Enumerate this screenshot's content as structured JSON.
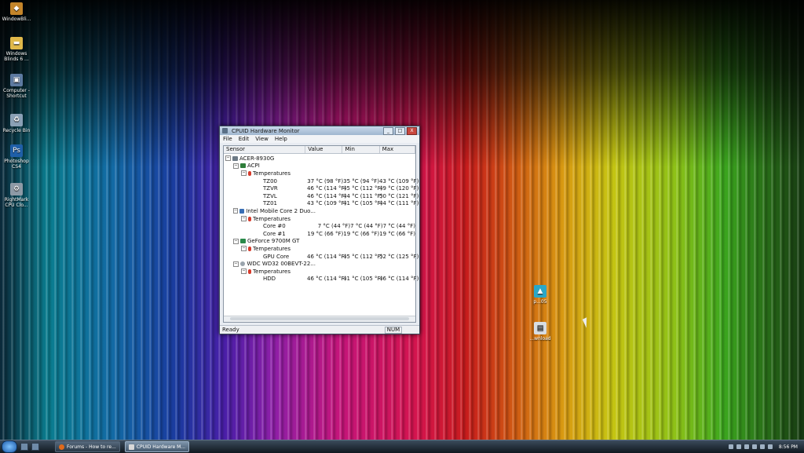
{
  "desktop": {
    "icons": [
      {
        "label": "WindowBli...",
        "icon": "windowblinds-icon",
        "color": "#c4852a"
      },
      {
        "label": "Windows Blinds 6 ...",
        "icon": "folder-icon",
        "color": "#e0b94a"
      },
      {
        "label": "Computer - Shortcut",
        "icon": "computer-icon",
        "color": "#5d7aa0"
      },
      {
        "label": "Recycle Bin",
        "icon": "recycle-bin-icon",
        "color": "#8aa0b5"
      },
      {
        "label": "Photoshop CS4",
        "icon": "photoshop-icon",
        "color": "#1f5fa8"
      },
      {
        "label": "RightMark CPU Clo...",
        "icon": "gear-icon",
        "color": "#8e9aa6"
      },
      {
        "label": "p...05",
        "icon": "image-icon",
        "color": "#2aa7c7"
      },
      {
        "label": "...wnload",
        "icon": "file-icon",
        "color": "#d8dde3"
      }
    ]
  },
  "window": {
    "title": "CPUID Hardware Monitor",
    "controls": {
      "minimize": "_",
      "maximize": "□",
      "close": "X"
    },
    "menu": [
      "File",
      "Edit",
      "View",
      "Help"
    ],
    "columns": [
      "Sensor",
      "Value",
      "Min",
      "Max"
    ],
    "rows": [
      {
        "label": "ACER-8930G",
        "value": "",
        "min": "",
        "max": ""
      },
      {
        "label": "ACPI",
        "value": "",
        "min": "",
        "max": ""
      },
      {
        "label": "Temperatures",
        "value": "",
        "min": "",
        "max": ""
      },
      {
        "label": "TZ00",
        "value": "37 °C  (98 °F)",
        "min": "35 °C  (94 °F)",
        "max": "43 °C  (109 °F)"
      },
      {
        "label": "TZVR",
        "value": "46 °C  (114 °F)",
        "min": "45 °C  (112 °F)",
        "max": "49 °C  (120 °F)"
      },
      {
        "label": "TZVL",
        "value": "46 °C  (114 °F)",
        "min": "44 °C  (111 °F)",
        "max": "50 °C  (121 °F)"
      },
      {
        "label": "TZ01",
        "value": "43 °C  (109 °F)",
        "min": "41 °C  (105 °F)",
        "max": "44 °C  (111 °F)"
      },
      {
        "label": "Intel Mobile Core 2 Duo...",
        "value": "",
        "min": "",
        "max": ""
      },
      {
        "label": "Temperatures",
        "value": "",
        "min": "",
        "max": ""
      },
      {
        "label": "Core #0",
        "value": "7 °C  (44 °F)",
        "min": "7 °C  (44 °F)",
        "max": "7 °C  (44 °F)"
      },
      {
        "label": "Core #1",
        "value": "19 °C  (66 °F)",
        "min": "19 °C  (66 °F)",
        "max": "19 °C  (66 °F)"
      },
      {
        "label": "GeForce 9700M GT",
        "value": "",
        "min": "",
        "max": ""
      },
      {
        "label": "Temperatures",
        "value": "",
        "min": "",
        "max": ""
      },
      {
        "label": "GPU Core",
        "value": "46 °C  (114 °F)",
        "min": "45 °C  (112 °F)",
        "max": "52 °C  (125 °F)"
      },
      {
        "label": "WDC WD32 00BEVT-22...",
        "value": "",
        "min": "",
        "max": ""
      },
      {
        "label": "Temperatures",
        "value": "",
        "min": "",
        "max": ""
      },
      {
        "label": "HDD",
        "value": "46 °C  (114 °F)",
        "min": "41 °C  (105 °F)",
        "max": "46 °C  (114 °F)"
      }
    ],
    "status": "Ready",
    "status_num": "NUM"
  },
  "taskbar": {
    "tasks": [
      {
        "label": "Forums - How to re...",
        "icon": "firefox-icon",
        "active": false,
        "color": "#e06a1b"
      },
      {
        "label": "CPUID Hardware M...",
        "icon": "cpuid-icon",
        "active": true,
        "color": "#d8d8d8"
      }
    ],
    "clock": "8:56 PM"
  }
}
